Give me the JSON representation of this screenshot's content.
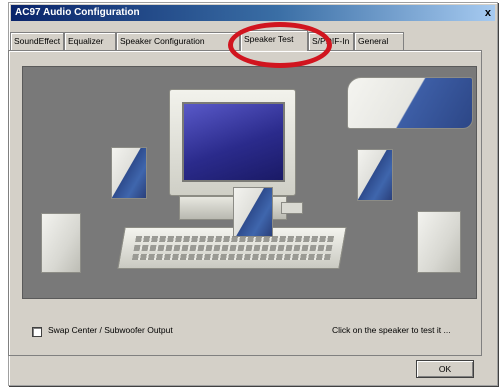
{
  "window": {
    "title": "AC97 Audio Configuration",
    "close_glyph": "x"
  },
  "tabs": [
    {
      "label": "SoundEffect"
    },
    {
      "label": "Equalizer"
    },
    {
      "label": "Speaker Configuration"
    },
    {
      "label": "Speaker Test"
    },
    {
      "label": "S/PDIF-In"
    },
    {
      "label": "General"
    }
  ],
  "active_tab": "Speaker Test",
  "controls": {
    "swap_label": "Swap Center / Subwoofer Output",
    "hint": "Click on the speaker to test it ...",
    "ok_label": "OK"
  },
  "colors": {
    "highlight": "#d1151f",
    "stage": "#797979",
    "speaker_accent": "#3f66ad"
  }
}
